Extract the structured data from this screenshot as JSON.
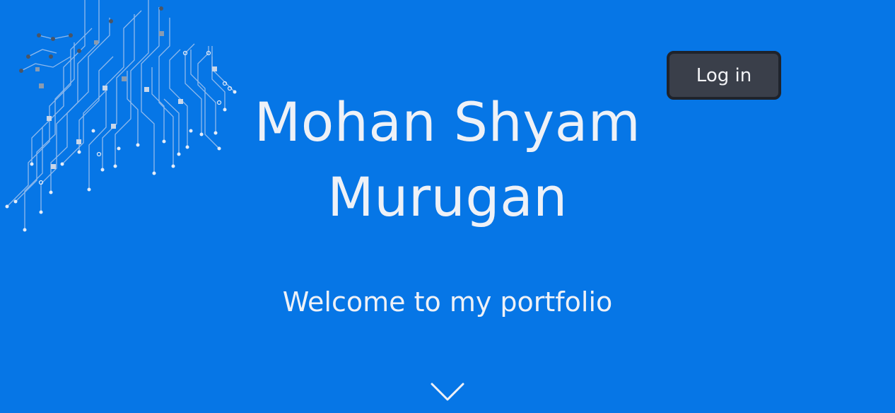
{
  "hero": {
    "name_line1": "Mohan Shyam",
    "name_line2": "Murugan",
    "welcome": "Welcome to my portfolio",
    "background_color": "#0676e6",
    "decoration_icon": "circuit-board-icon",
    "scroll_icon": "chevron-down-icon"
  },
  "nav": {
    "login_label": "Log in"
  }
}
